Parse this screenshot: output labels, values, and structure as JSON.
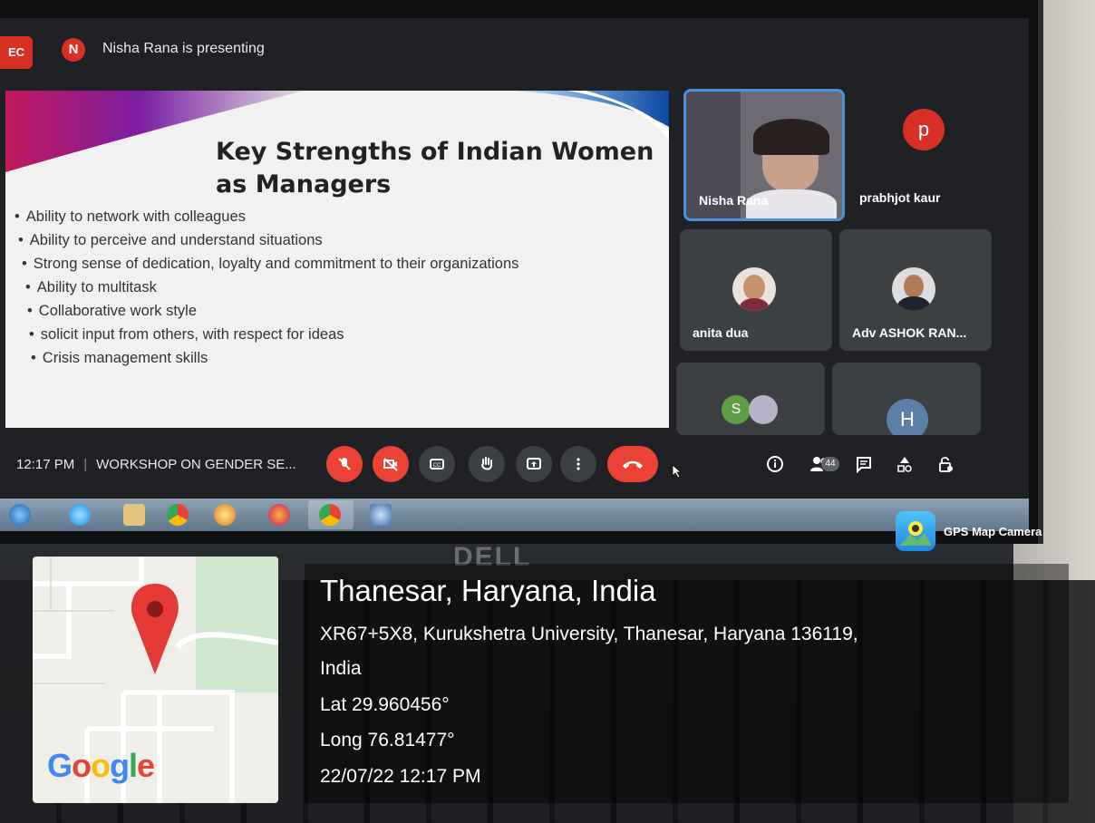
{
  "meeting": {
    "rec_label": "EC",
    "presenter_initial": "N",
    "presenter_text": "Nisha Rana is presenting",
    "time": "12:17 PM",
    "title": "WORKSHOP ON GENDER SE...",
    "participant_count": "44"
  },
  "slide": {
    "title": "Key Strengths of Indian Women as Managers",
    "bullets": [
      "Ability to network with colleagues",
      "Ability to perceive and understand situations",
      "Strong sense of dedication, loyalty and commitment to their organizations",
      "Ability to multitask",
      "Collaborative work style",
      "solicit input from others, with respect for ideas",
      "Crisis management skills"
    ]
  },
  "participants": [
    {
      "name": "Nisha Rana"
    },
    {
      "name": "prabhjot kaur",
      "initial": "p"
    },
    {
      "name": "anita dua"
    },
    {
      "name": "Adv ASHOK RAN..."
    },
    {
      "name": "",
      "initial": "S"
    },
    {
      "name": "",
      "initial": "H"
    }
  ],
  "controls": {
    "icons": [
      "mic-off-icon",
      "camera-off-icon",
      "captions-icon",
      "raise-hand-icon",
      "present-icon",
      "more-options-icon",
      "hang-up-icon"
    ],
    "right_icons": [
      "info-icon",
      "people-icon",
      "chat-icon",
      "activities-icon",
      "host-controls-icon"
    ]
  },
  "gps": {
    "app_name": "GPS Map Camera",
    "location_title": "Thanesar, Haryana, India",
    "address_line1": "XR67+5X8, Kurukshetra University, Thanesar, Haryana 136119,",
    "address_line2": "India",
    "latitude": "Lat 29.960456°",
    "longitude": "Long 76.81477°",
    "datetime": "22/07/22 12:17 PM",
    "map_brand": "Google"
  },
  "hardware": {
    "brand": "DELL"
  },
  "colors": {
    "meet_red": "#ea4335",
    "meet_bg": "#202124",
    "tile_bg": "#3c4043"
  }
}
